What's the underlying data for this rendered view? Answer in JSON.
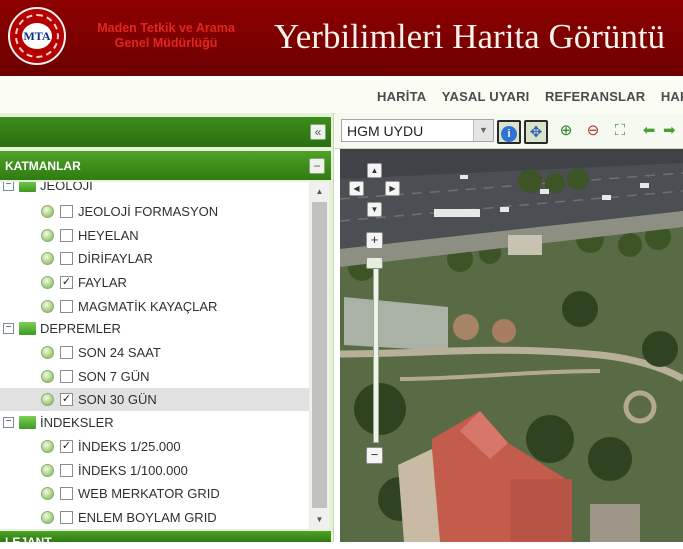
{
  "header": {
    "logo_text": "MTA",
    "org_line1": "Maden Tetkik ve Arama",
    "org_line2": "Genel Müdürlüğü",
    "title": "Yerbilimleri Harita Görüntü",
    "bg_color": "#7d0000"
  },
  "nav": {
    "items": [
      {
        "label": "HARİTA"
      },
      {
        "label": "YASAL UYARI"
      },
      {
        "label": "REFERANSLAR"
      },
      {
        "label": "HAK"
      }
    ]
  },
  "panel": {
    "collapse_glyph": "«",
    "layers_title": "KATMANLAR",
    "layers_toggle": "−",
    "footer_title": "LEJANT"
  },
  "tree": {
    "groups": [
      {
        "label": "JEOLOJİ",
        "items": [
          {
            "label": "JEOLOJİ FORMASYON",
            "checked": false
          },
          {
            "label": "HEYELAN",
            "checked": false
          },
          {
            "label": "DİRİFAYLAR",
            "checked": false
          },
          {
            "label": "FAYLAR",
            "checked": true
          },
          {
            "label": "MAGMATİK KAYAÇLAR",
            "checked": false
          }
        ]
      },
      {
        "label": "DEPREMLER",
        "items": [
          {
            "label": "SON 24 SAAT",
            "checked": false
          },
          {
            "label": "SON 7 GÜN",
            "checked": false
          },
          {
            "label": "SON 30 GÜN",
            "checked": true,
            "selected": true
          }
        ]
      },
      {
        "label": "İNDEKSLER",
        "items": [
          {
            "label": "İNDEKS 1/25.000",
            "checked": true
          },
          {
            "label": "İNDEKS 1/100.000",
            "checked": false
          },
          {
            "label": "WEB MERKATOR GRID",
            "checked": false
          },
          {
            "label": "ENLEM BOYLAM GRID",
            "checked": false
          }
        ]
      }
    ]
  },
  "map": {
    "basemap_selected": "HGM UYDU",
    "tools": [
      {
        "name": "info-icon",
        "glyph": "i",
        "active": true
      },
      {
        "name": "pan-icon",
        "glyph": "✥",
        "active": true
      },
      {
        "name": "zoom-in-tool-icon",
        "glyph": "⊕",
        "active": false
      },
      {
        "name": "zoom-out-tool-icon",
        "glyph": "⊖",
        "active": false
      },
      {
        "name": "full-extent-icon",
        "glyph": "⛶",
        "active": false
      },
      {
        "name": "back-arrow-icon",
        "glyph": "⬅",
        "active": false
      },
      {
        "name": "forward-arrow-icon",
        "glyph": "➡",
        "active": false
      }
    ],
    "zoom_plus": "+",
    "zoom_minus": "−"
  },
  "colors": {
    "accent_green": "#3d8f1b",
    "title_text": "#f6f1ea",
    "org_text": "#e2261f"
  }
}
